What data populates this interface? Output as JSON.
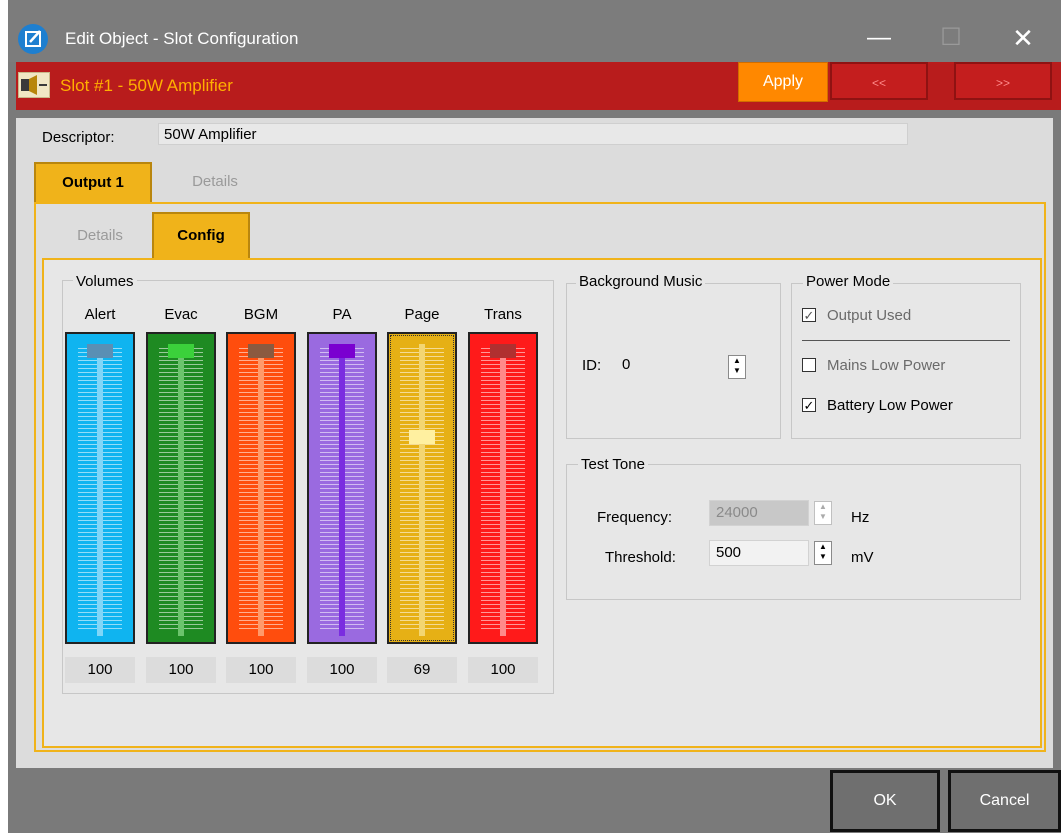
{
  "window": {
    "title": "Edit Object - Slot Configuration",
    "minimize": "—",
    "maximize": "☐",
    "close": "✕"
  },
  "slot": {
    "icon": "amplifier-50-icon",
    "title": "Slot #1 - 50W Amplifier",
    "apply_label": "Apply",
    "prev_label": "<<",
    "next_label": ">>"
  },
  "descriptor": {
    "label": "Descriptor:",
    "value": "50W Amplifier"
  },
  "outer_tabs": [
    {
      "label": "Output 1",
      "active": true
    },
    {
      "label": "Details",
      "active": false
    }
  ],
  "inner_tabs": [
    {
      "label": "Details",
      "active": false
    },
    {
      "label": "Config",
      "active": true
    }
  ],
  "volumes": {
    "title": "Volumes",
    "sliders": [
      {
        "label": "Alert",
        "value": "100",
        "level": 100,
        "bg": "#0fb4f0",
        "thumb": "#5a8fb4",
        "track": "#7fd6f8"
      },
      {
        "label": "Evac",
        "value": "100",
        "level": 100,
        "bg": "#1e8a22",
        "thumb": "#3bd13b",
        "track": "#6cc46c"
      },
      {
        "label": "BGM",
        "value": "100",
        "level": 100,
        "bg": "#ff4d0d",
        "thumb": "#8a5a40",
        "track": "#ff9a6a"
      },
      {
        "label": "PA",
        "value": "100",
        "level": 100,
        "bg": "#9a6ae0",
        "thumb": "#7a00d0",
        "track": "#7a2de0"
      },
      {
        "label": "Page",
        "value": "69",
        "level": 69,
        "bg": "#e6b015",
        "thumb": "#fff0a0",
        "track": "#f3d672"
      },
      {
        "label": "Trans",
        "value": "100",
        "level": 100,
        "bg": "#ff1a1a",
        "thumb": "#b03030",
        "track": "#ff8a8a"
      }
    ]
  },
  "background_music": {
    "title": "Background Music",
    "id_label": "ID:",
    "id_value": "0"
  },
  "power_mode": {
    "title": "Power Mode",
    "options": [
      {
        "label": "Output Used",
        "checked": true,
        "disabled": true
      },
      {
        "label": "Mains Low Power",
        "checked": false,
        "disabled": true
      },
      {
        "label": "Battery Low Power",
        "checked": true,
        "disabled": false
      }
    ]
  },
  "test_tone": {
    "title": "Test Tone",
    "frequency_label": "Frequency:",
    "frequency_value": "24000",
    "frequency_unit": "Hz",
    "threshold_label": "Threshold:",
    "threshold_value": "500",
    "threshold_unit": "mV"
  },
  "footer": {
    "ok_label": "OK",
    "cancel_label": "Cancel"
  }
}
